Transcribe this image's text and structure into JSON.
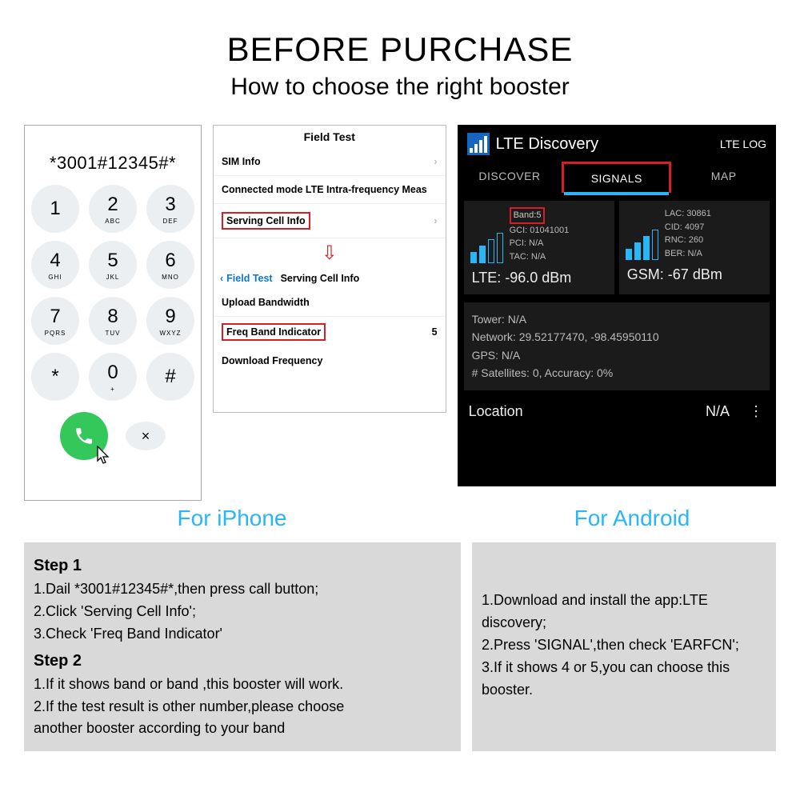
{
  "header": {
    "title": "BEFORE PURCHASE",
    "subtitle": "How to choose the right booster"
  },
  "dialer": {
    "display": "*3001#12345#*",
    "keys": [
      {
        "n": "1",
        "s": ""
      },
      {
        "n": "2",
        "s": "ABC"
      },
      {
        "n": "3",
        "s": "DEF"
      },
      {
        "n": "4",
        "s": "GHI"
      },
      {
        "n": "5",
        "s": "JKL"
      },
      {
        "n": "6",
        "s": "MNO"
      },
      {
        "n": "7",
        "s": "PQRS"
      },
      {
        "n": "8",
        "s": "TUV"
      },
      {
        "n": "9",
        "s": "WXYZ"
      },
      {
        "n": "*",
        "s": ""
      },
      {
        "n": "0",
        "s": "+"
      },
      {
        "n": "#",
        "s": ""
      }
    ],
    "delete": "×"
  },
  "fieldtest": {
    "title": "Field Test",
    "sim": "SIM Info",
    "connected": "Connected mode LTE Intra-frequency Meas",
    "serving": "Serving Cell Info",
    "back": "Field Test",
    "serving2": "Serving Cell Info",
    "upload": "Upload Bandwidth",
    "freq_ind": "Freq Band Indicator",
    "freq_val": "5",
    "download": "Download Frequency"
  },
  "android": {
    "title": "LTE Discovery",
    "right": "LTE LOG",
    "tabs": [
      "DISCOVER",
      "SIGNALS",
      "MAP"
    ],
    "lte": {
      "band": "Band:5",
      "lines": [
        "GCI: 01041001",
        "PCI: N/A",
        "TAC: N/A"
      ],
      "dbm": "LTE: -96.0 dBm"
    },
    "gsm": {
      "lines": [
        "LAC: 30861",
        "CID: 4097",
        "RNC: 260",
        "BER: N/A"
      ],
      "dbm": "GSM: -67 dBm"
    },
    "info": [
      "Tower: N/A",
      "Network: 29.52177470, -98.45950110",
      "GPS: N/A",
      "# Satellites: 0, Accuracy: 0%"
    ],
    "location_label": "Location",
    "location_value": "N/A"
  },
  "platforms": {
    "iphone": "For  iPhone",
    "android": "For Android"
  },
  "steps": {
    "iphone": {
      "s1_title": "Step 1",
      "s1": [
        "1.Dail *3001#12345#*,then press call button;",
        "2.Click  'Serving Cell Info';",
        "3.Check 'Freq Band Indicator'"
      ],
      "s2_title": "Step 2",
      "s2": [
        "1.If it shows band      or band      ,this booster will work.",
        "2.If the test result is other number,please choose",
        "another booster according to your band"
      ]
    },
    "android": [
      "1.Download and install the app:LTE discovery;",
      "2.Press 'SIGNAL',then check 'EARFCN';",
      "3.If it shows 4 or 5,you can choose this booster."
    ]
  }
}
